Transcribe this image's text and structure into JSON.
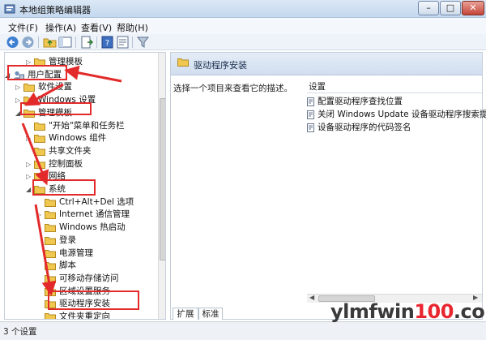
{
  "window": {
    "title": "本地组策略编辑器",
    "min": "–",
    "max": "□",
    "close": "✕"
  },
  "menu": [
    "文件(F)",
    "操作(A)",
    "查看(V)",
    "帮助(H)"
  ],
  "tree": [
    {
      "label": "管理模板",
      "twisty": "▷",
      "level": 2,
      "icon": "folder"
    },
    {
      "label": "用户配置",
      "twisty": "◢",
      "level": 0,
      "icon": "user-config"
    },
    {
      "label": "软件设置",
      "twisty": "▷",
      "level": 1,
      "icon": "folder"
    },
    {
      "label": "Windows 设置",
      "twisty": "▷",
      "level": 1,
      "icon": "folder"
    },
    {
      "label": "管理模板",
      "twisty": "◢",
      "level": 1,
      "icon": "folder"
    },
    {
      "label": "\"开始\"菜单和任务栏",
      "twisty": "",
      "level": 2,
      "icon": "folder"
    },
    {
      "label": "Windows 组件",
      "twisty": "▷",
      "level": 2,
      "icon": "folder"
    },
    {
      "label": "共享文件夹",
      "twisty": "",
      "level": 2,
      "icon": "folder"
    },
    {
      "label": "控制面板",
      "twisty": "▷",
      "level": 2,
      "icon": "folder"
    },
    {
      "label": "网络",
      "twisty": "▷",
      "level": 2,
      "icon": "folder"
    },
    {
      "label": "系统",
      "twisty": "◢",
      "level": 2,
      "icon": "folder"
    },
    {
      "label": "Ctrl+Alt+Del 选项",
      "twisty": "",
      "level": 3,
      "icon": "folder"
    },
    {
      "label": "Internet 通信管理",
      "twisty": "▷",
      "level": 3,
      "icon": "folder"
    },
    {
      "label": "Windows 热启动",
      "twisty": "",
      "level": 3,
      "icon": "folder"
    },
    {
      "label": "登录",
      "twisty": "",
      "level": 3,
      "icon": "folder"
    },
    {
      "label": "电源管理",
      "twisty": "",
      "level": 3,
      "icon": "folder"
    },
    {
      "label": "脚本",
      "twisty": "",
      "level": 3,
      "icon": "folder"
    },
    {
      "label": "可移动存储访问",
      "twisty": "",
      "level": 3,
      "icon": "folder"
    },
    {
      "label": "区域设置服务",
      "twisty": "",
      "level": 3,
      "icon": "folder"
    },
    {
      "label": "驱动程序安装",
      "twisty": "",
      "level": 3,
      "icon": "folder"
    },
    {
      "label": "文件夹重定向",
      "twisty": "",
      "level": 3,
      "icon": "folder"
    }
  ],
  "right": {
    "header": "驱动程序安装",
    "description": "选择一个项目来查看它的描述。",
    "column": "设置",
    "settings": [
      "配置驱动程序查找位置",
      "关闭 Windows Update 设备驱动程序搜索提示",
      "设备驱动程序的代码签名"
    ],
    "tabs": [
      "扩展",
      "标准"
    ]
  },
  "status": "3 个设置",
  "watermark": {
    "main": "ylmfwin",
    "accent": "100",
    "suffix": ".com"
  },
  "colors": {
    "highlight": "#e32a2a",
    "folder": "#f0c850",
    "header_bg": "#d6e2f2"
  }
}
